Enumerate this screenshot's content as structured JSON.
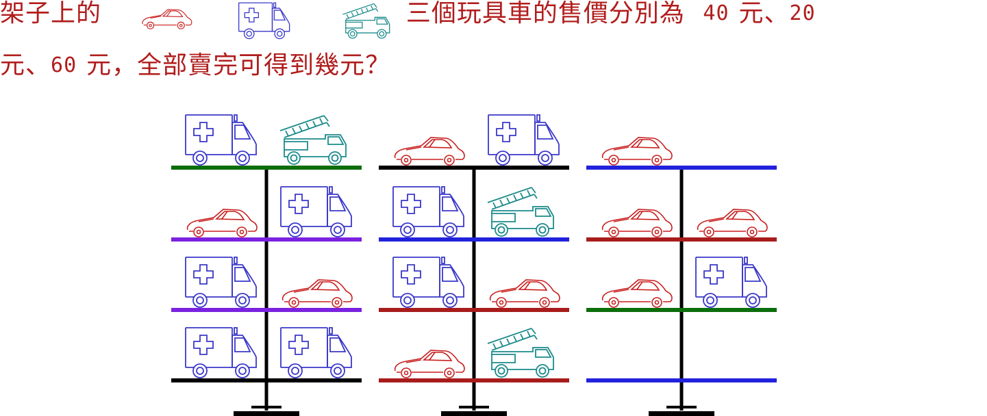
{
  "question": {
    "line1_part1": "架子上的",
    "line1_part2": "三個玩具車的售價分別為",
    "price1": "40",
    "unit1": "元、",
    "price2": "20",
    "line2_unit": "元、",
    "price3": "60",
    "line2_rest": "元，全部賣完可得到幾元？"
  },
  "colors": {
    "text": "#b11d1d",
    "car": "#c81e1e",
    "ambulance": "#3a37c8",
    "firetruck": "#1a8a8a",
    "green": "#0b6e0b",
    "purple": "#7a22e0",
    "blue": "#2222dd",
    "darkred": "#a81c1c",
    "black": "#000000"
  },
  "toys": [
    "car-icon",
    "ambulance-icon",
    "fire-truck-icon"
  ],
  "shelves": [
    {
      "name": "shelf-1",
      "levels": [
        {
          "color": "green",
          "left": "ambulance",
          "right": "firetruck"
        },
        {
          "color": "purple",
          "left": "car",
          "right": "ambulance"
        },
        {
          "color": "purple",
          "left": "ambulance",
          "right": "car"
        },
        {
          "color": "black",
          "left": "ambulance",
          "right": "ambulance"
        }
      ]
    },
    {
      "name": "shelf-2",
      "levels": [
        {
          "color": "black",
          "left": "car",
          "right": "ambulance"
        },
        {
          "color": "blue",
          "left": "ambulance",
          "right": "firetruck"
        },
        {
          "color": "darkred",
          "left": "ambulance",
          "right": "car"
        },
        {
          "color": "darkred",
          "left": "car",
          "right": "firetruck"
        }
      ]
    },
    {
      "name": "shelf-3",
      "levels": [
        {
          "color": "blue",
          "left": "car",
          "right": ""
        },
        {
          "color": "darkred",
          "left": "car",
          "right": "car"
        },
        {
          "color": "green",
          "left": "car",
          "right": "ambulance"
        },
        {
          "color": "blue",
          "left": "",
          "right": ""
        }
      ]
    }
  ]
}
